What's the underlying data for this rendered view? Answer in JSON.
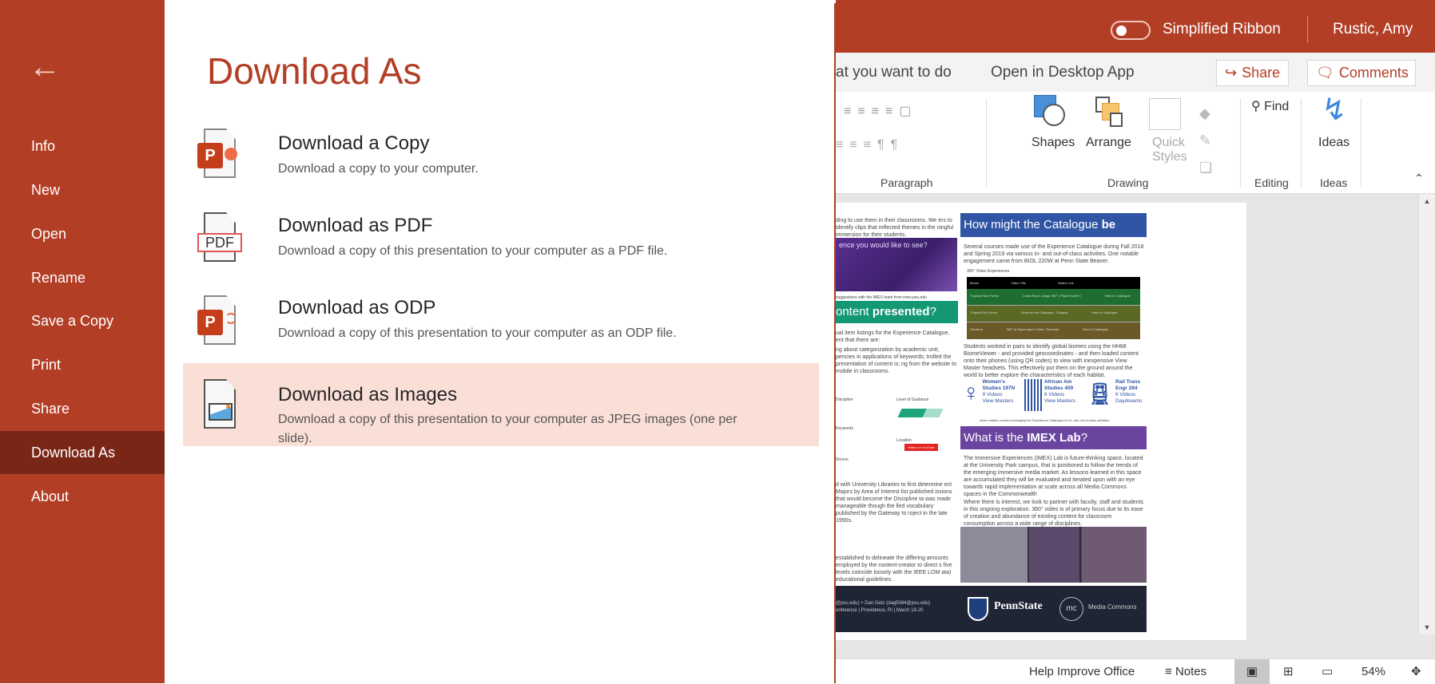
{
  "sidebar": {
    "back_icon": "arrow-left",
    "items": [
      {
        "label": "Info"
      },
      {
        "label": "New"
      },
      {
        "label": "Open"
      },
      {
        "label": "Rename"
      },
      {
        "label": "Save a Copy"
      },
      {
        "label": "Print"
      },
      {
        "label": "Share"
      },
      {
        "label": "Download As",
        "selected": true
      },
      {
        "label": "About"
      }
    ]
  },
  "panel": {
    "title": "Download As",
    "options": [
      {
        "title": "Download a Copy",
        "desc": "Download a copy to your computer.",
        "icon": "pptx-file-icon"
      },
      {
        "title": "Download as PDF",
        "desc": "Download a copy of this presentation to your computer as a PDF file.",
        "icon": "pdf-file-icon",
        "icon_text": "PDF"
      },
      {
        "title": "Download as ODP",
        "desc": "Download a copy of this presentation to your computer as an ODP file.",
        "icon": "odp-file-icon"
      },
      {
        "title": "Download as Images",
        "desc": "Download a copy of this presentation to your computer as JPEG images (one per slide).",
        "icon": "image-file-icon",
        "selected": true
      }
    ]
  },
  "topbar": {
    "simplified_ribbon": "Simplified Ribbon",
    "simplified_ribbon_on": false,
    "user": "Rustic, Amy"
  },
  "tabs": {
    "tell_me": "at you want to do",
    "open_desktop": "Open in Desktop App",
    "share": "Share",
    "comments": "Comments"
  },
  "ribbon": {
    "groups": {
      "paragraph": "Paragraph",
      "drawing": "Drawing",
      "editing": "Editing",
      "ideas": "Ideas"
    },
    "shapes": "Shapes",
    "arrange": "Arrange",
    "quick": "Quick",
    "styles": "Styles",
    "find": "Find",
    "ideas_btn": "Ideas"
  },
  "slide": {
    "l1": "ding to use them in their classrooms. We ers to identify clips that reflected themes in the ningful immersion for their students.",
    "l_img": "ence you would like to see?",
    "l_cap": "suggestions with the IMEX team from imex.psu.edu",
    "l_head": "ontent ",
    "l_head_b": "presented",
    "l2": "ual item listings for the Experience Catalogue, ent that there are:",
    "l3": "ng about categorization by academic unit; pencies in applications of keywords; trolled the presentation of content is; ng from the website to mobile in classrooms.",
    "l_form1": "Discipline",
    "l_form2": "Level of Guidance",
    "l_form3": "Keywords",
    "l_form4": "Location",
    "l_form5": "Source",
    "l_yt": "Watch on YouTube",
    "l4": "d with University Libraries to first determine ect Majors by Area of Interest list published issions that would become the Discipline ta was made manageable though the lled vocabulary published by the Gateway to roject in the late 1990s.",
    "l5": "established to delineate the differing amounts employed by the content-creator to direct s five levels coincide loosely with the IEEE LOM ata) educational guidelines.",
    "l_foot": "@psu.edu) + Dan Getz (dag5084@psu.edu) onference | Providence, RI | March 18-20",
    "r_head": "How might the Catalogue ",
    "r_head_b": "be used",
    "r1": "Several courses made use of the Experience Catalogue during Fall 2018 and Spring 2019 via various in- and out-of-class activities. One notable engagement came from BIOL 220W at Penn State Beaver.",
    "r_table_title": "360° Video Experiences",
    "r_table": [
      {
        "a": "Biome",
        "b": "Video Title",
        "c": "Watch Link"
      },
      {
        "a": "Tropical Rain Forest",
        "b": "Costa Rican Jungle 360° | Planet Earth II",
        "c": "View in Catalogue"
      },
      {
        "a": "Tropical Dry Forest",
        "b": "Selva de las Cataratas - Chiapas",
        "c": "View in Catalogue"
      },
      {
        "a": "Savanna",
        "b": "360° at Ngorongoro Crater, Tanzania",
        "c": "View in Catalogue"
      }
    ],
    "r2": "Students worked in pairs to identify global biomes using the HHMI BiomeViewer - and provided geocoordinates - and then loaded content onto their phones (using QR codes) to view with inexpensive View Master headsets. This effectively put them on the ground around the world to better explore the characteristics of each habitat.",
    "courses": [
      {
        "a": "Women's",
        "b": "Studies 197N",
        "c": "9 Videos",
        "d": "View Masters"
      },
      {
        "a": "African Am",
        "b": "Studies 409",
        "c": "6 Videos",
        "d": "View Masters"
      },
      {
        "a": "Rail Trans",
        "b": "Engr 294",
        "c": "6 Videos",
        "d": "Daydreams"
      }
    ],
    "r_cap": "other notable courses leveraging the Experience Catalogue for in- and out-of-class activities",
    "imex_head": "What is the ",
    "imex_head_b": "IMEX Lab",
    "r3": "The Immersive Experiences (IMEX) Lab is future-thinking space, located at the University Park campus, that is positioned to follow the trends of the emerging immersive media market. As lessons learned in this space are accumulated they will be evaluated and iterated upon with an eye towards rapid implementation at scale across all Media Commons spaces in the Commonwealth",
    "r4": "Where there is interest, we look to partner with faculty, staff and students in this ongoing exploration. 360° video is of primary focus due to its ease of creation and abundance of existing content for classroom consumption across a wide range of disciplines.",
    "pennstate": "PennState",
    "mediacommons": "Media Commons",
    "mc": "mc"
  },
  "status": {
    "help": "Help Improve Office",
    "notes": "Notes",
    "zoom": "54%"
  },
  "colors": {
    "accent": "#B33E26",
    "selected_nav": "#7A2617",
    "selected_option": "#FADFD7",
    "slide_blue": "#2F55A4",
    "slide_green": "#149773",
    "slide_purple": "#6A45A0",
    "slide_footer": "#1F2535"
  }
}
